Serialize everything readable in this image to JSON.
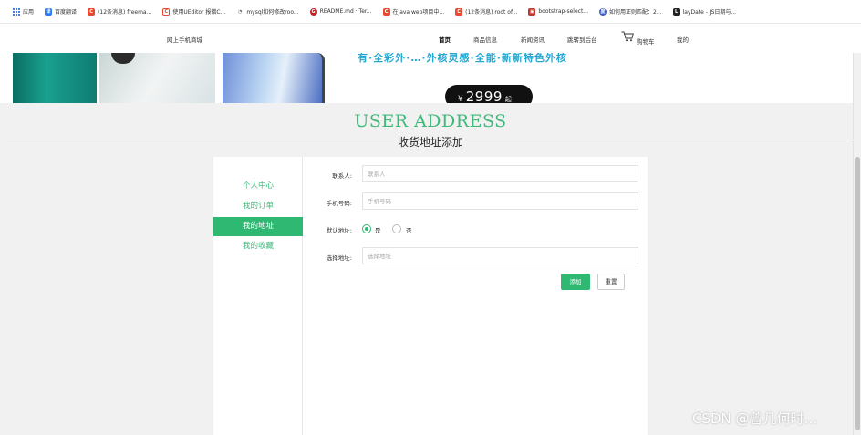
{
  "bookmarks": [
    {
      "label": "应用",
      "icon": "apps-grid-icon",
      "color": "#4a7bd6"
    },
    {
      "label": "百度翻译",
      "icon": "baidu-translate-icon",
      "color": "#2d7cf6"
    },
    {
      "label": "(12条消息) freema...",
      "icon": "csdn-icon",
      "color": "#e84a2f"
    },
    {
      "label": "使用UEditor 报错C...",
      "icon": "c-icon",
      "color": "#e84a2f"
    },
    {
      "label": "mysql如何修改roo...",
      "icon": "mysql-icon",
      "color": "#555555"
    },
    {
      "label": "README.md · Ter...",
      "icon": "gitee-icon",
      "color": "#c71d23"
    },
    {
      "label": "在java web项目中...",
      "icon": "csdn-icon",
      "color": "#e84a2f"
    },
    {
      "label": "(12条消息) root of...",
      "icon": "csdn-icon",
      "color": "#e84a2f"
    },
    {
      "label": "bootstrap-select...",
      "icon": "bootstrap-icon",
      "color": "#c0392b"
    },
    {
      "label": "如何用正则匹配：2...",
      "icon": "baidu-icon",
      "color": "#3b5dc9"
    },
    {
      "label": "layDate - JS日期与...",
      "icon": "laydate-icon",
      "color": "#222222"
    }
  ],
  "nav": {
    "brand": "网上手机商城",
    "items": [
      "首页",
      "商品信息",
      "新闻资讯",
      "跳转到后台",
      "购物车",
      "我的"
    ],
    "active_index": 0
  },
  "banner": {
    "slogan": "有·全彩外·…·外核灵感·全能·新新特色外核",
    "currency": "¥",
    "price": "2999",
    "price_suffix": "起"
  },
  "page": {
    "title_en": "USER ADDRESS",
    "title_cn": "收货地址添加"
  },
  "sidebar": {
    "items": [
      "个人中心",
      "我的订单",
      "我的地址",
      "我的收藏"
    ],
    "active_index": 2
  },
  "form": {
    "contact_label": "联系人:",
    "contact_placeholder": "联系人",
    "phone_label": "手机号码:",
    "phone_placeholder": "手机号码",
    "default_label": "默认地址:",
    "default_yes": "是",
    "default_no": "否",
    "default_selected": "是",
    "address_label": "选择地址:",
    "address_placeholder": "选择地址",
    "add_button": "添加",
    "reset_button": "重置"
  },
  "watermark": "CSDN @曾几何时…",
  "colors": {
    "accent": "#2eb872",
    "title_green": "#3fb97a",
    "slogan_blue": "#26a7cf"
  }
}
